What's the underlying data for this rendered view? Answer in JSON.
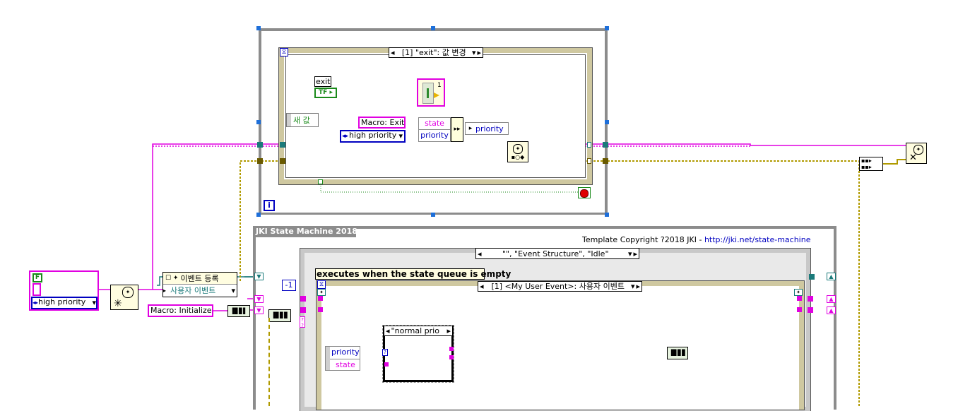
{
  "event_loop": {
    "case_selector": "[1] \"exit\": 값 변경",
    "exit_terminal_label": "exit",
    "exit_terminal_type": "TF",
    "new_value_label": "새 값",
    "macro_exit": "Macro: Exit",
    "priority_dropdown": "high priority",
    "bundle_state": "state",
    "bundle_priority": "priority",
    "unbundle_priority": "priority",
    "index_const": "1",
    "loop_iteration": "i"
  },
  "left_controls": {
    "bool_const": "F",
    "cluster_priority": "high priority",
    "register_events_title": "이벤트 등록",
    "user_event_label": "사용자 이벤트",
    "macro_initialize": "Macro: Initialize"
  },
  "jki": {
    "title": "JKI State Machine 2018",
    "copyright_text": "Template Copyright ?2018 JKI - ",
    "copyright_link": "http://jki.net/state-machine",
    "case_selector": "\"\", \"Event Structure\", \"Idle\"",
    "comment": "executes when the state queue is empty",
    "timeout_const": "-1",
    "event_selector": "[1] <My User Event>: 사용자 이벤트",
    "inner_case_selector": "\"normal prio",
    "unbundle_priority": "priority",
    "unbundle_state": "state"
  },
  "colors": {
    "pink_wire": "#e100e1",
    "teal_wire": "#1a7a7a",
    "olive_wire": "#8a7a00",
    "enum_blue": "#0000c0",
    "frame_gray": "#8c8c8c"
  }
}
